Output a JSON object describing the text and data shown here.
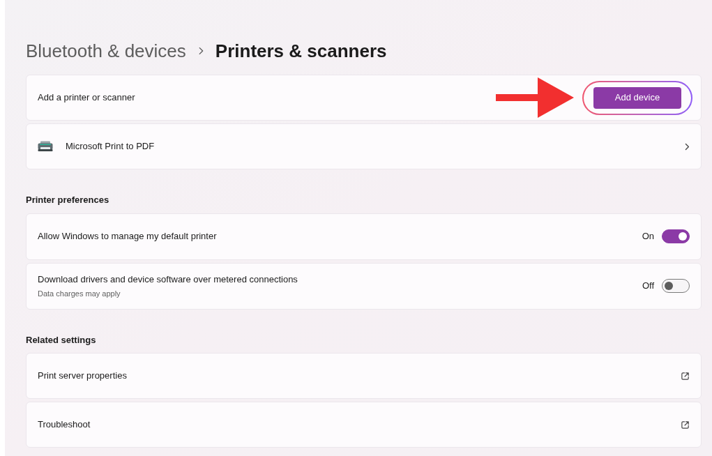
{
  "breadcrumb": {
    "parent": "Bluetooth & devices",
    "current": "Printers & scanners"
  },
  "add_row": {
    "label": "Add a printer or scanner",
    "button": "Add device"
  },
  "devices": [
    {
      "name": "Microsoft Print to PDF"
    }
  ],
  "printer_preferences": {
    "heading": "Printer preferences",
    "items": [
      {
        "label": "Allow Windows to manage my default printer",
        "state_text": "On",
        "on": true
      },
      {
        "label": "Download drivers and device software over metered connections",
        "description": "Data charges may apply",
        "state_text": "Off",
        "on": false
      }
    ]
  },
  "related_settings": {
    "heading": "Related settings",
    "items": [
      {
        "label": "Print server properties"
      },
      {
        "label": "Troubleshoot"
      }
    ]
  }
}
